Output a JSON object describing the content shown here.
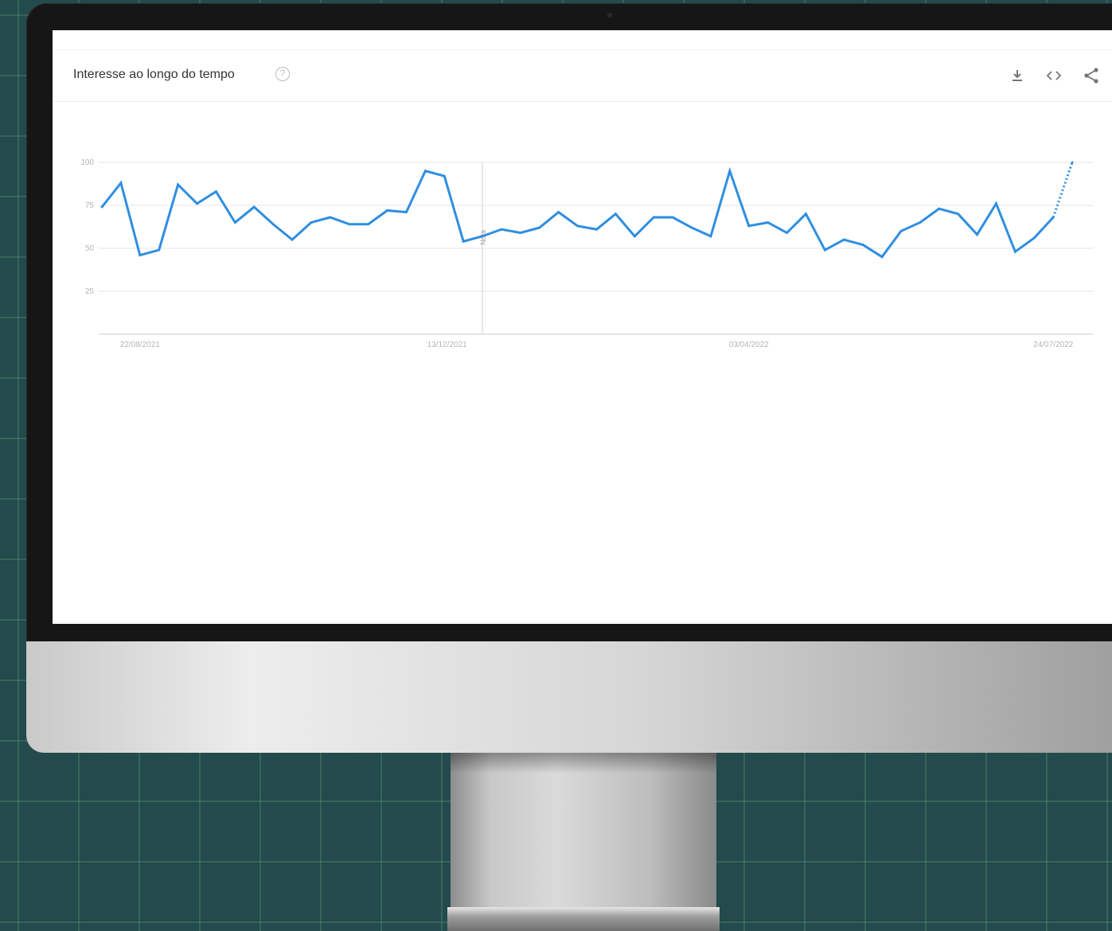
{
  "card": {
    "title": "Interesse ao longo do tempo",
    "help_glyph": "?"
  },
  "toolbar": {
    "download_icon": "download-icon",
    "embed_icon": "embed-icon",
    "share_icon": "share-icon"
  },
  "colors": {
    "series": "#2f8ee0",
    "grid": "#e6e6e6",
    "axis": "#cfcfcf"
  },
  "chart_data": {
    "type": "line",
    "title": "",
    "xlabel": "",
    "ylabel": "",
    "ylim": [
      0,
      100
    ],
    "yticks": [
      "25",
      "50",
      "75",
      "100"
    ],
    "xticks": [
      "22/08/2021",
      "13/12/2021",
      "03/04/2022",
      "24/07/2022"
    ],
    "note": {
      "label": "Nota",
      "week": "2021-12-26"
    },
    "x": [
      "2021-08-08",
      "2021-08-15",
      "2021-08-22",
      "2021-08-29",
      "2021-09-05",
      "2021-09-12",
      "2021-09-19",
      "2021-09-26",
      "2021-10-03",
      "2021-10-10",
      "2021-10-17",
      "2021-10-24",
      "2021-10-31",
      "2021-11-07",
      "2021-11-14",
      "2021-11-21",
      "2021-11-28",
      "2021-12-05",
      "2021-12-12",
      "2021-12-19",
      "2021-12-26",
      "2022-01-02",
      "2022-01-09",
      "2022-01-16",
      "2022-01-23",
      "2022-01-30",
      "2022-02-06",
      "2022-02-13",
      "2022-02-20",
      "2022-02-27",
      "2022-03-06",
      "2022-03-13",
      "2022-03-20",
      "2022-03-27",
      "2022-04-03",
      "2022-04-10",
      "2022-04-17",
      "2022-04-24",
      "2022-05-01",
      "2022-05-08",
      "2022-05-15",
      "2022-05-22",
      "2022-05-29",
      "2022-06-05",
      "2022-06-12",
      "2022-06-19",
      "2022-06-26",
      "2022-07-03",
      "2022-07-10",
      "2022-07-17",
      "2022-07-24",
      "2022-07-31",
      "2022-08-07"
    ],
    "series": [
      {
        "values": [
          74,
          88,
          46,
          49,
          87,
          76,
          83,
          65,
          74,
          64,
          55,
          65,
          68,
          64,
          64,
          72,
          71,
          95,
          92,
          54,
          57,
          61,
          59,
          62,
          71,
          63,
          61,
          70,
          57,
          68,
          68,
          62,
          57,
          95,
          63,
          65,
          59,
          70,
          49,
          55,
          52,
          45,
          60,
          65,
          73,
          70,
          58,
          76,
          48,
          56,
          68,
          100
        ],
        "partial_from_index": 50
      }
    ]
  }
}
